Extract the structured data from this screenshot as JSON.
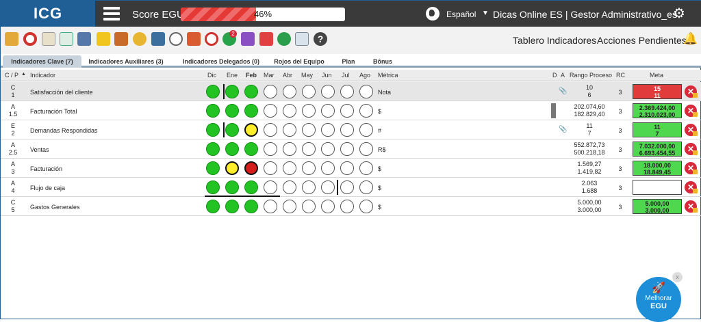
{
  "topbar": {
    "logo": "ICG",
    "score_label": "Score EGU:",
    "score_value": "46%",
    "score_fraction": 0.46,
    "language": "Español",
    "online_text": "Dicas Online ES  |  Gestor Administrativo_es"
  },
  "nav": {
    "tablero": "Tablero Indicadores",
    "acciones": "Acciones Pendientes",
    "badge": "2"
  },
  "tabs": [
    {
      "label": "Indicadores Clave (7)"
    },
    {
      "label": "Indicadores Auxiliares (3)"
    },
    {
      "label": "Indicadores Delegados (0)"
    },
    {
      "label": "Rojos del Equipo"
    },
    {
      "label": "Plan"
    },
    {
      "label": "Bônus"
    }
  ],
  "headers": {
    "cp": "C / P",
    "indicador": "Indicador",
    "months": [
      "Dic",
      "Ene",
      "Feb",
      "Mar",
      "Abr",
      "May",
      "Jun",
      "Jul",
      "Ago"
    ],
    "metrica": "Métrica",
    "d": "D",
    "a": "A",
    "rango": "Rango Proceso",
    "rc": "RC",
    "meta": "Meta"
  },
  "rows": [
    {
      "cp1": "C",
      "cp2": "1",
      "name": "Satisfacción del cliente",
      "metric": "Nota",
      "rango1": "10",
      "rango2": "6",
      "rc": "3",
      "meta1": "15",
      "meta2": "11",
      "meta_style": "red",
      "status": [
        "g",
        "g",
        "g",
        "",
        "",
        "",
        "",
        "",
        ""
      ]
    },
    {
      "cp1": "A",
      "cp2": "1.5",
      "name": "Facturación Total",
      "metric": "$",
      "rango1": "202.074,60",
      "rango2": "182.829,40",
      "rc": "3",
      "meta1": "2.369.424,00",
      "meta2": "2.310.023,00",
      "meta_style": "green",
      "status": [
        "g",
        "g",
        "g",
        "",
        "",
        "",
        "",
        "",
        ""
      ]
    },
    {
      "cp1": "E",
      "cp2": "2",
      "name": "Demandas Respondidas",
      "metric": "#",
      "rango1": "11",
      "rango2": "7",
      "rc": "3",
      "meta1": "11",
      "meta2": "7",
      "meta_style": "green",
      "status": [
        "g",
        "g",
        "y",
        "",
        "",
        "",
        "",
        "",
        ""
      ]
    },
    {
      "cp1": "A",
      "cp2": "2.5",
      "name": "Ventas",
      "metric": "R$",
      "rango1": "552.872,73",
      "rango2": "500.218,18",
      "rc": "3",
      "meta1": "7.032.000,00",
      "meta2": "6.693.454,55",
      "meta_style": "green",
      "status": [
        "g",
        "g",
        "g",
        "",
        "",
        "",
        "",
        "",
        ""
      ]
    },
    {
      "cp1": "A",
      "cp2": "3",
      "name": "Facturación",
      "metric": "$",
      "rango1": "1.569,27",
      "rango2": "1.419,82",
      "rc": "3",
      "meta1": "18.000,00",
      "meta2": "18.849,45",
      "meta_style": "green",
      "status": [
        "g",
        "y",
        "r",
        "",
        "",
        "",
        "",
        "",
        ""
      ]
    },
    {
      "cp1": "A",
      "cp2": "4",
      "name": "Flujo de caja",
      "metric": "$",
      "rango1": "2.063",
      "rango2": "1.688",
      "rc": "3",
      "meta1": "",
      "meta2": "",
      "meta_style": "empty",
      "status": [
        "g",
        "g",
        "g",
        "",
        "",
        "",
        "",
        "",
        ""
      ]
    },
    {
      "cp1": "C",
      "cp2": "5",
      "name": "Gastos Generales",
      "metric": "$",
      "rango1": "5.000,00",
      "rango2": "3.000,00",
      "rc": "3",
      "meta1": "5.000,00",
      "meta2": "3.000,00",
      "meta_style": "green",
      "status": [
        "g",
        "g",
        "g",
        "",
        "",
        "",
        "",
        "",
        ""
      ]
    }
  ],
  "float": {
    "line1": "Melhorar",
    "line2": "EGU",
    "close": "x"
  }
}
